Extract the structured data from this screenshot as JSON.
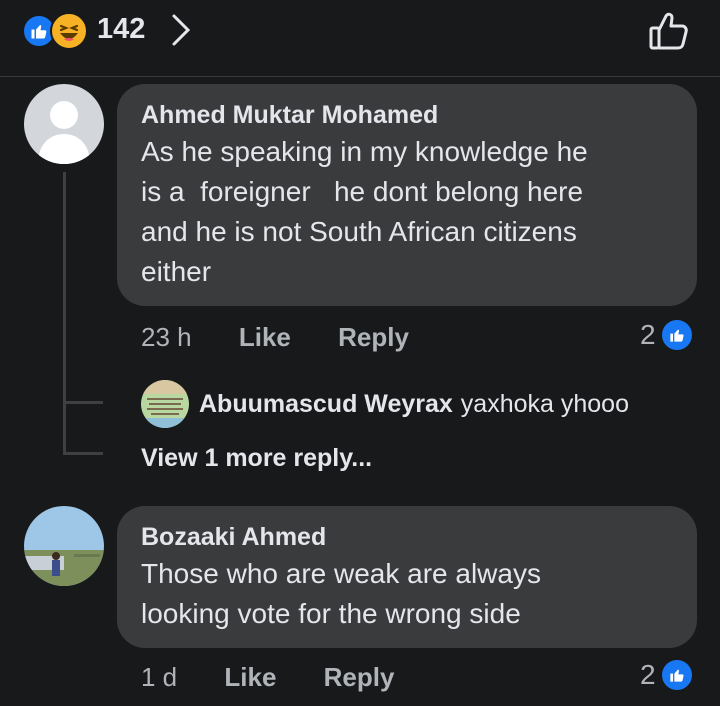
{
  "header": {
    "reaction_count": "142",
    "reaction_icons": [
      "like-icon",
      "haha-icon"
    ]
  },
  "comments": [
    {
      "author": "Ahmed Muktar Mohamed",
      "text_lines": [
        "As he speaking in my knowledge he",
        "is a  foreigner   he dont belong here",
        "and he is not South African citizens",
        "either"
      ],
      "time": "23 h",
      "like_label": "Like",
      "reply_label": "Reply",
      "reaction_count": "2",
      "replies": [
        {
          "author": "Abuumascud Weyrax",
          "text": "yaxhoka yhooo"
        }
      ],
      "view_more": "View 1 more reply..."
    },
    {
      "author": "Bozaaki Ahmed",
      "text_lines": [
        "Those who are weak are always",
        "looking vote for the wrong side"
      ],
      "time": "1 d",
      "like_label": "Like",
      "reply_label": "Reply",
      "reaction_count": "2"
    }
  ],
  "colors": {
    "background": "#18191a",
    "bubble": "#3a3b3c",
    "accent_blue": "#1877f2",
    "secondary_text": "#b0b3b8"
  }
}
